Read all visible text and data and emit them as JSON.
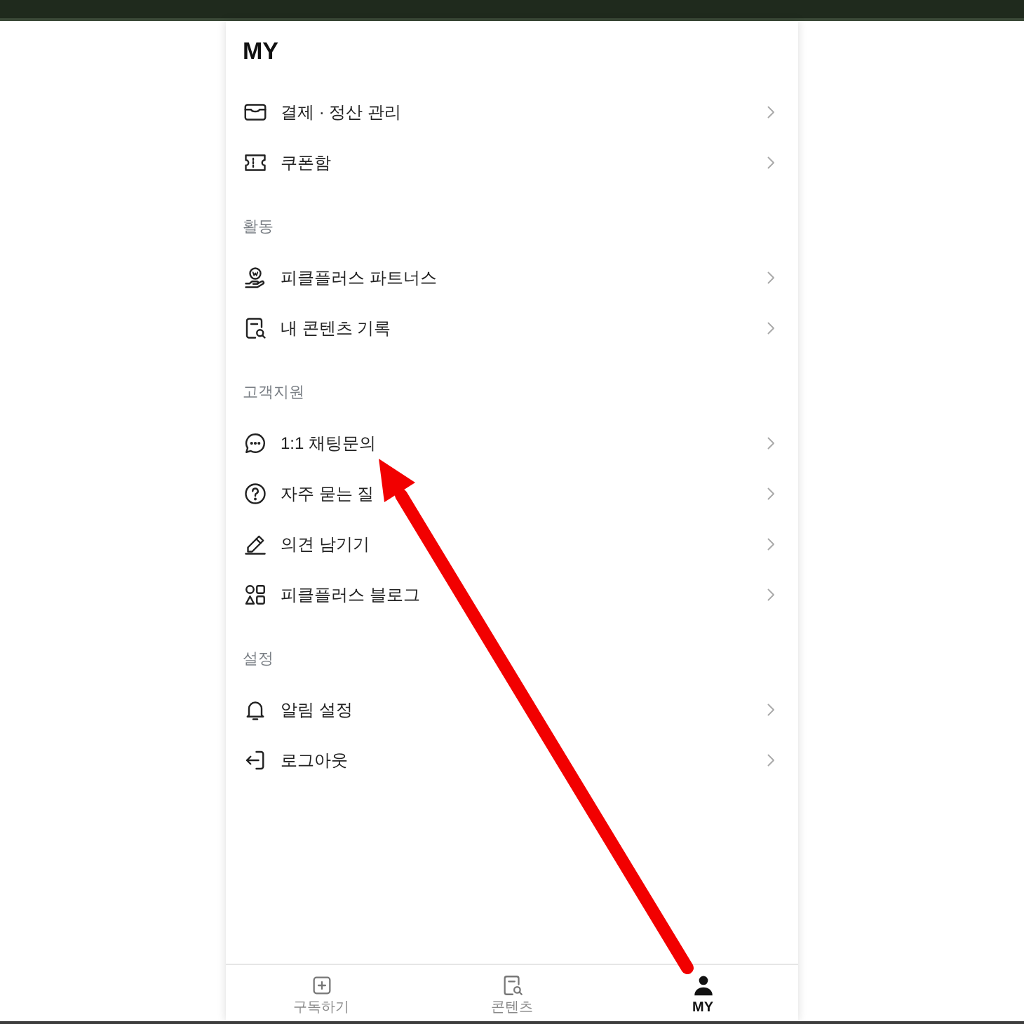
{
  "page": {
    "title": "MY"
  },
  "sections": [
    {
      "items": [
        {
          "label": "결제 · 정산 관리"
        },
        {
          "label": "쿠폰함"
        }
      ]
    },
    {
      "title": "활동",
      "items": [
        {
          "label": "피클플러스 파트너스"
        },
        {
          "label": "내 콘텐츠 기록"
        }
      ]
    },
    {
      "title": "고객지원",
      "items": [
        {
          "label": "1:1 채팅문의"
        },
        {
          "label": "자주 묻는 질"
        },
        {
          "label": "의견 남기기"
        },
        {
          "label": "피클플러스 블로그"
        }
      ]
    },
    {
      "title": "설정",
      "items": [
        {
          "label": "알림 설정"
        },
        {
          "label": "로그아웃"
        }
      ]
    }
  ],
  "bottom_nav": [
    {
      "label": "구독하기",
      "selected": false
    },
    {
      "label": "콘텐츠",
      "selected": false
    },
    {
      "label": "MY",
      "selected": true
    }
  ]
}
